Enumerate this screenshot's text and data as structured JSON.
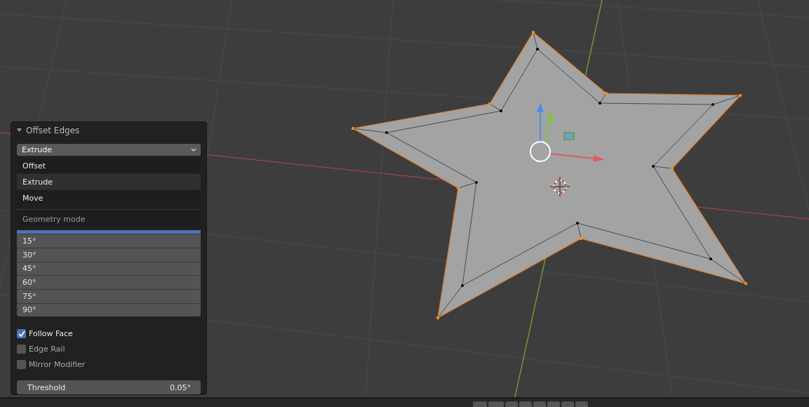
{
  "panel": {
    "title": "Offset Edges",
    "expanded": true,
    "mode_field": {
      "value": "Extrude"
    },
    "mode_menu": {
      "items": [
        {
          "label": "Offset",
          "selected": false
        },
        {
          "label": "Extrude",
          "selected": true
        },
        {
          "label": "Move",
          "selected": false
        }
      ],
      "section": "Geometry mode"
    },
    "angle_list": [
      "15°",
      "30°",
      "45°",
      "60°",
      "75°",
      "90°"
    ],
    "options": [
      {
        "label": "Follow Face",
        "checked": true
      },
      {
        "label": "Edge Rail",
        "checked": false
      },
      {
        "label": "Mirror Modifier",
        "checked": false
      }
    ],
    "threshold": {
      "label": "Threshold",
      "value": "0.05°"
    }
  }
}
